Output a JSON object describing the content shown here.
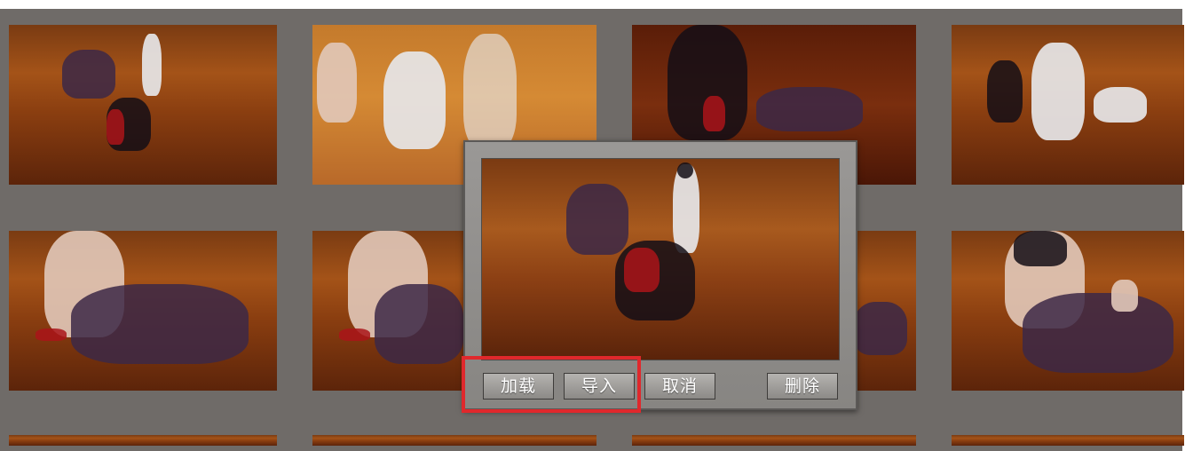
{
  "dialog": {
    "buttons": {
      "load": "加载",
      "import": "导入",
      "cancel": "取消",
      "delete": "删除"
    }
  },
  "gallery": {
    "thumbnails": [
      {
        "id": "scene-1",
        "tone": "normal"
      },
      {
        "id": "scene-2",
        "tone": "light"
      },
      {
        "id": "scene-3",
        "tone": "dark"
      },
      {
        "id": "scene-4",
        "tone": "normal"
      },
      {
        "id": "scene-5",
        "tone": "normal"
      },
      {
        "id": "scene-6",
        "tone": "normal"
      },
      {
        "id": "scene-7",
        "tone": "normal"
      },
      {
        "id": "scene-8",
        "tone": "normal"
      }
    ]
  },
  "colors": {
    "background": "#6f6b68",
    "highlight": "#e0282c",
    "button_text": "#ffffff"
  }
}
